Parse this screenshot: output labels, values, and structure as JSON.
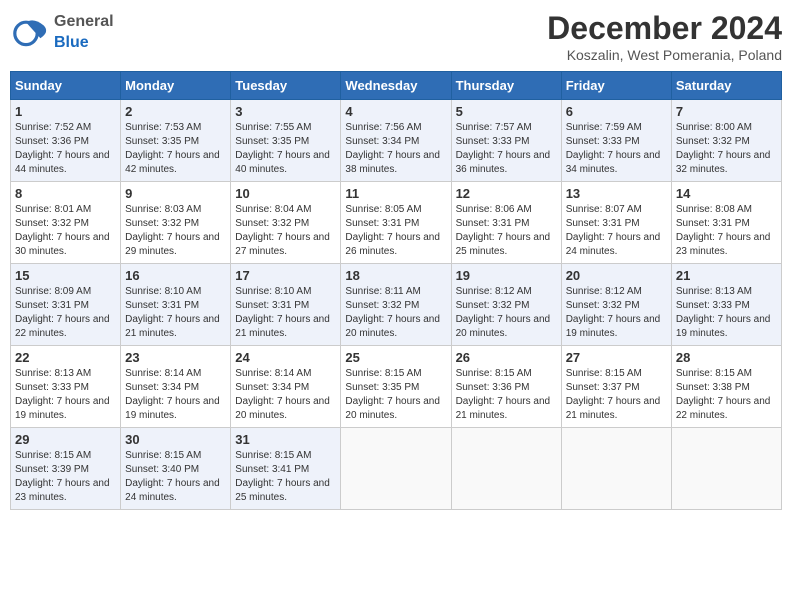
{
  "header": {
    "logo_general": "General",
    "logo_blue": "Blue",
    "title": "December 2024",
    "subtitle": "Koszalin, West Pomerania, Poland"
  },
  "weekdays": [
    "Sunday",
    "Monday",
    "Tuesday",
    "Wednesday",
    "Thursday",
    "Friday",
    "Saturday"
  ],
  "weeks": [
    [
      {
        "day": "1",
        "sunrise": "Sunrise: 7:52 AM",
        "sunset": "Sunset: 3:36 PM",
        "daylight": "Daylight: 7 hours and 44 minutes."
      },
      {
        "day": "2",
        "sunrise": "Sunrise: 7:53 AM",
        "sunset": "Sunset: 3:35 PM",
        "daylight": "Daylight: 7 hours and 42 minutes."
      },
      {
        "day": "3",
        "sunrise": "Sunrise: 7:55 AM",
        "sunset": "Sunset: 3:35 PM",
        "daylight": "Daylight: 7 hours and 40 minutes."
      },
      {
        "day": "4",
        "sunrise": "Sunrise: 7:56 AM",
        "sunset": "Sunset: 3:34 PM",
        "daylight": "Daylight: 7 hours and 38 minutes."
      },
      {
        "day": "5",
        "sunrise": "Sunrise: 7:57 AM",
        "sunset": "Sunset: 3:33 PM",
        "daylight": "Daylight: 7 hours and 36 minutes."
      },
      {
        "day": "6",
        "sunrise": "Sunrise: 7:59 AM",
        "sunset": "Sunset: 3:33 PM",
        "daylight": "Daylight: 7 hours and 34 minutes."
      },
      {
        "day": "7",
        "sunrise": "Sunrise: 8:00 AM",
        "sunset": "Sunset: 3:32 PM",
        "daylight": "Daylight: 7 hours and 32 minutes."
      }
    ],
    [
      {
        "day": "8",
        "sunrise": "Sunrise: 8:01 AM",
        "sunset": "Sunset: 3:32 PM",
        "daylight": "Daylight: 7 hours and 30 minutes."
      },
      {
        "day": "9",
        "sunrise": "Sunrise: 8:03 AM",
        "sunset": "Sunset: 3:32 PM",
        "daylight": "Daylight: 7 hours and 29 minutes."
      },
      {
        "day": "10",
        "sunrise": "Sunrise: 8:04 AM",
        "sunset": "Sunset: 3:32 PM",
        "daylight": "Daylight: 7 hours and 27 minutes."
      },
      {
        "day": "11",
        "sunrise": "Sunrise: 8:05 AM",
        "sunset": "Sunset: 3:31 PM",
        "daylight": "Daylight: 7 hours and 26 minutes."
      },
      {
        "day": "12",
        "sunrise": "Sunrise: 8:06 AM",
        "sunset": "Sunset: 3:31 PM",
        "daylight": "Daylight: 7 hours and 25 minutes."
      },
      {
        "day": "13",
        "sunrise": "Sunrise: 8:07 AM",
        "sunset": "Sunset: 3:31 PM",
        "daylight": "Daylight: 7 hours and 24 minutes."
      },
      {
        "day": "14",
        "sunrise": "Sunrise: 8:08 AM",
        "sunset": "Sunset: 3:31 PM",
        "daylight": "Daylight: 7 hours and 23 minutes."
      }
    ],
    [
      {
        "day": "15",
        "sunrise": "Sunrise: 8:09 AM",
        "sunset": "Sunset: 3:31 PM",
        "daylight": "Daylight: 7 hours and 22 minutes."
      },
      {
        "day": "16",
        "sunrise": "Sunrise: 8:10 AM",
        "sunset": "Sunset: 3:31 PM",
        "daylight": "Daylight: 7 hours and 21 minutes."
      },
      {
        "day": "17",
        "sunrise": "Sunrise: 8:10 AM",
        "sunset": "Sunset: 3:31 PM",
        "daylight": "Daylight: 7 hours and 21 minutes."
      },
      {
        "day": "18",
        "sunrise": "Sunrise: 8:11 AM",
        "sunset": "Sunset: 3:32 PM",
        "daylight": "Daylight: 7 hours and 20 minutes."
      },
      {
        "day": "19",
        "sunrise": "Sunrise: 8:12 AM",
        "sunset": "Sunset: 3:32 PM",
        "daylight": "Daylight: 7 hours and 20 minutes."
      },
      {
        "day": "20",
        "sunrise": "Sunrise: 8:12 AM",
        "sunset": "Sunset: 3:32 PM",
        "daylight": "Daylight: 7 hours and 19 minutes."
      },
      {
        "day": "21",
        "sunrise": "Sunrise: 8:13 AM",
        "sunset": "Sunset: 3:33 PM",
        "daylight": "Daylight: 7 hours and 19 minutes."
      }
    ],
    [
      {
        "day": "22",
        "sunrise": "Sunrise: 8:13 AM",
        "sunset": "Sunset: 3:33 PM",
        "daylight": "Daylight: 7 hours and 19 minutes."
      },
      {
        "day": "23",
        "sunrise": "Sunrise: 8:14 AM",
        "sunset": "Sunset: 3:34 PM",
        "daylight": "Daylight: 7 hours and 19 minutes."
      },
      {
        "day": "24",
        "sunrise": "Sunrise: 8:14 AM",
        "sunset": "Sunset: 3:34 PM",
        "daylight": "Daylight: 7 hours and 20 minutes."
      },
      {
        "day": "25",
        "sunrise": "Sunrise: 8:15 AM",
        "sunset": "Sunset: 3:35 PM",
        "daylight": "Daylight: 7 hours and 20 minutes."
      },
      {
        "day": "26",
        "sunrise": "Sunrise: 8:15 AM",
        "sunset": "Sunset: 3:36 PM",
        "daylight": "Daylight: 7 hours and 21 minutes."
      },
      {
        "day": "27",
        "sunrise": "Sunrise: 8:15 AM",
        "sunset": "Sunset: 3:37 PM",
        "daylight": "Daylight: 7 hours and 21 minutes."
      },
      {
        "day": "28",
        "sunrise": "Sunrise: 8:15 AM",
        "sunset": "Sunset: 3:38 PM",
        "daylight": "Daylight: 7 hours and 22 minutes."
      }
    ],
    [
      {
        "day": "29",
        "sunrise": "Sunrise: 8:15 AM",
        "sunset": "Sunset: 3:39 PM",
        "daylight": "Daylight: 7 hours and 23 minutes."
      },
      {
        "day": "30",
        "sunrise": "Sunrise: 8:15 AM",
        "sunset": "Sunset: 3:40 PM",
        "daylight": "Daylight: 7 hours and 24 minutes."
      },
      {
        "day": "31",
        "sunrise": "Sunrise: 8:15 AM",
        "sunset": "Sunset: 3:41 PM",
        "daylight": "Daylight: 7 hours and 25 minutes."
      },
      null,
      null,
      null,
      null
    ]
  ]
}
